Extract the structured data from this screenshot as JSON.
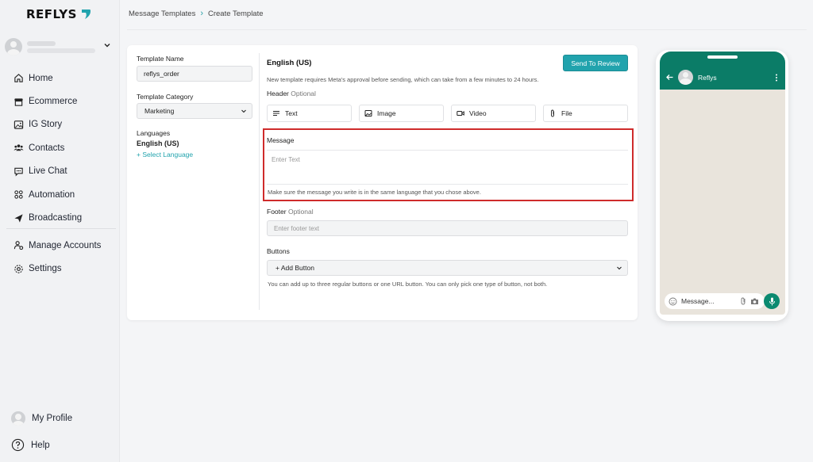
{
  "brand": {
    "name": "REFLYS",
    "accent": "#21a3ad"
  },
  "sidebar": {
    "items": [
      {
        "label": "Home",
        "icon": "home-icon"
      },
      {
        "label": "Ecommerce",
        "icon": "store-icon"
      },
      {
        "label": "IG Story",
        "icon": "image-icon"
      },
      {
        "label": "Contacts",
        "icon": "users-icon"
      },
      {
        "label": "Live Chat",
        "icon": "chat-icon"
      },
      {
        "label": "Automation",
        "icon": "automation-icon"
      },
      {
        "label": "Broadcasting",
        "icon": "send-icon"
      }
    ],
    "items2": [
      {
        "label": "Manage Accounts",
        "icon": "user-cog-icon"
      },
      {
        "label": "Settings",
        "icon": "gear-icon"
      }
    ],
    "profile_label": "My Profile",
    "help_label": "Help"
  },
  "breadcrumb": {
    "parent": "Message Templates",
    "current": "Create Template"
  },
  "form": {
    "template_name_label": "Template Name",
    "template_name_value": "reflys_order",
    "template_category_label": "Template Category",
    "template_category_value": "Marketing",
    "languages_label": "Languages",
    "language_value": "English (US)",
    "select_language_link": "+ Select Language"
  },
  "editor": {
    "language_title": "English (US)",
    "send_button": "Send To Review",
    "approval_note": "New template requires Meta's approval before sending, which can take from a few minutes to 24 hours.",
    "header_label": "Header",
    "optional": "Optional",
    "header_types": [
      {
        "label": "Text",
        "icon": "text-icon"
      },
      {
        "label": "Image",
        "icon": "image-icon"
      },
      {
        "label": "Video",
        "icon": "video-icon"
      },
      {
        "label": "File",
        "icon": "paperclip-icon"
      }
    ],
    "message_label": "Message",
    "message_placeholder": "Enter Text",
    "message_note": "Make sure the message you write is in the same language that you chose above.",
    "footer_label": "Footer",
    "footer_placeholder": "Enter footer text",
    "buttons_label": "Buttons",
    "add_button": "+ Add Button",
    "buttons_note": "You can add up to three regular buttons or one URL button. You can only pick one type of button, not both."
  },
  "phone": {
    "contact_name": "Reflys",
    "input_placeholder": "Message...",
    "header_color": "#0b7c67",
    "chat_bg": "#e9e4dc"
  }
}
